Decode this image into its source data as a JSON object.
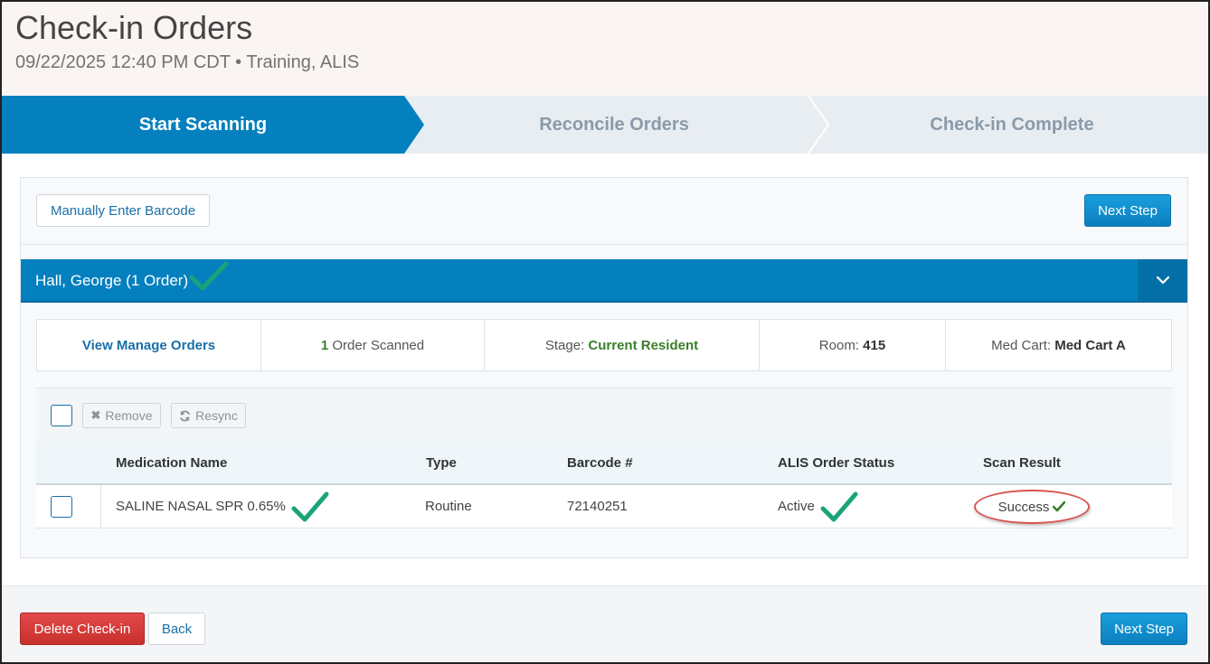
{
  "header": {
    "title": "Check-in Orders",
    "subtitle": "09/22/2025 12:40 PM CDT • Training, ALIS"
  },
  "stepper": {
    "steps": [
      {
        "label": "Start Scanning",
        "active": true
      },
      {
        "label": "Reconcile Orders",
        "active": false
      },
      {
        "label": "Check-in Complete",
        "active": false
      }
    ]
  },
  "toolbar": {
    "manual_barcode_label": "Manually Enter Barcode",
    "next_step_label": "Next Step"
  },
  "resident": {
    "name": "Hall, George (1 Order)",
    "info": {
      "view_manage_orders": "View Manage Orders",
      "scanned_count": "1",
      "scanned_label": "Order Scanned",
      "stage_label": "Stage:",
      "stage_value": "Current Resident",
      "room_label": "Room:",
      "room_value": "415",
      "med_cart_label": "Med Cart:",
      "med_cart_value": "Med Cart A"
    }
  },
  "table": {
    "tools": {
      "remove_label": "Remove",
      "resync_label": "Resync"
    },
    "columns": [
      "Medication Name",
      "Type",
      "Barcode #",
      "ALIS Order Status",
      "Scan Result"
    ],
    "rows": [
      {
        "medication": "SALINE NASAL SPR 0.65%",
        "type": "Routine",
        "barcode": "72140251",
        "status": "Active",
        "scan_result": "Success"
      }
    ]
  },
  "footer": {
    "delete_label": "Delete Check-in",
    "back_label": "Back",
    "next_step_label": "Next Step"
  },
  "colors": {
    "primary": "#0480be",
    "success_green": "#3a7d2c",
    "annotation_check": "#1aa37a",
    "danger": "#c9302c"
  }
}
